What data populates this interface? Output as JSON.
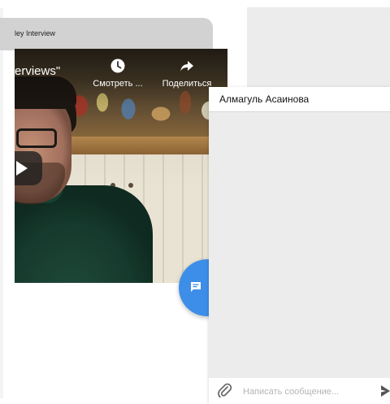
{
  "video_card": {
    "title": "ley Interview",
    "video_title": "erviews\"",
    "watch_later_label": "Смотреть ...",
    "share_label": "Поделиться"
  },
  "chat": {
    "contact_name": "Алмагуль Асаинова",
    "message_placeholder": "Написать сообщение...",
    "accent_color": "#3d8ee8"
  },
  "icons": [
    "clock-icon",
    "share-arrow-icon",
    "play-icon",
    "chat-bubble-icon",
    "paperclip-icon",
    "send-icon"
  ]
}
